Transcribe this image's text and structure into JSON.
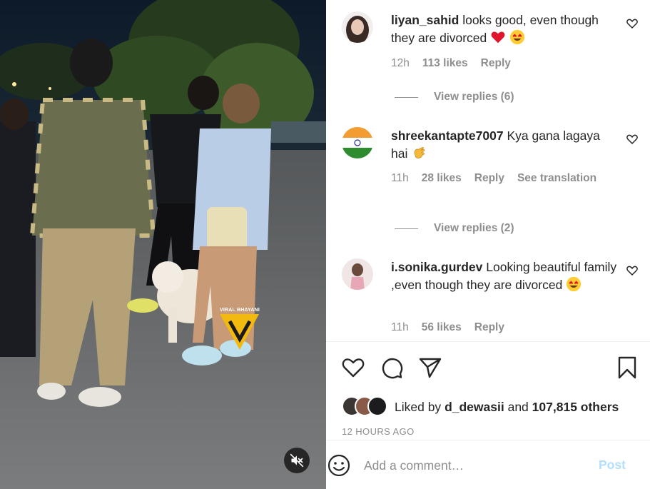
{
  "media": {
    "watermark_text": "VIRAL BHAYANI",
    "mute_icon": "speaker-muted-icon"
  },
  "comments": [
    {
      "username": "liyan_sahid",
      "text": "looks good, even though they are divorced",
      "emojis": [
        "red-heart",
        "heart-eyes-face"
      ],
      "time": "12h",
      "likes": "113 likes",
      "reply": "Reply",
      "view_replies": "View replies (6)"
    },
    {
      "username": "shreekantapte7007",
      "text": "Kya gana lagaya hai",
      "emojis": [
        "clapping-hands"
      ],
      "time": "11h",
      "likes": "28 likes",
      "reply": "Reply",
      "translation": "See translation",
      "view_replies": "View replies (2)"
    },
    {
      "username": "i.sonika.gurdev",
      "text": "Looking beautiful family ,even though they are divorced",
      "emojis": [
        "heart-eyes-face"
      ],
      "time": "11h",
      "likes": "56 likes",
      "reply": "Reply"
    }
  ],
  "actions": {
    "icons": [
      "heart-icon",
      "comment-icon",
      "share-icon",
      "bookmark-icon"
    ]
  },
  "liked_by": {
    "prefix": "Liked by",
    "user": "d_dewasii",
    "conjunction": "and",
    "others": "107,815 others"
  },
  "timestamp": "12 HOURS AGO",
  "comment_box": {
    "placeholder": "Add a comment…",
    "post_label": "Post"
  },
  "colors": {
    "link_post_disabled": "#b2dffc",
    "muted_text": "#8e8e8e",
    "heart_red": "#ed1c24"
  }
}
